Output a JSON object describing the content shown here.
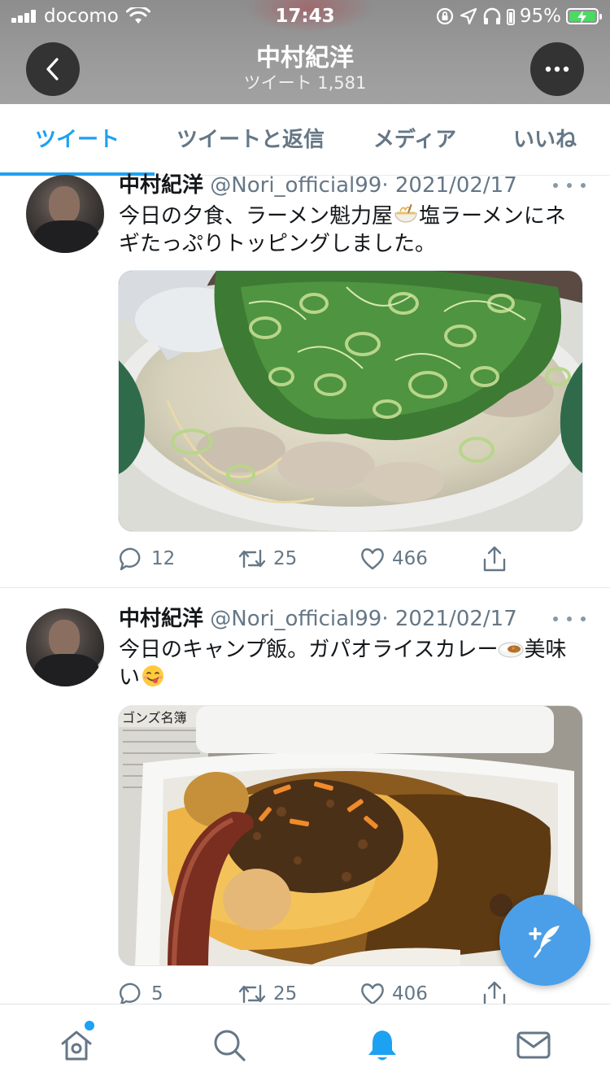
{
  "status_bar": {
    "carrier": "docomo",
    "time": "17:43",
    "battery_percent": "95%",
    "icons": [
      "signal-icon",
      "wifi-icon",
      "orientation-lock-icon",
      "location-icon",
      "headphones-icon",
      "battery-charging-icon"
    ]
  },
  "header": {
    "title": "中村紀洋",
    "subtitle": "ツイート 1,581",
    "back_icon": "chevron-left-icon",
    "more_icon": "more-horizontal-icon"
  },
  "tabs": [
    {
      "label": "ツイート",
      "active": true
    },
    {
      "label": "ツイートと返信",
      "active": false
    },
    {
      "label": "メディア",
      "active": false
    },
    {
      "label": "いいね",
      "active": false
    }
  ],
  "tweets": [
    {
      "name": "中村紀洋",
      "handle": "@Nori_official99",
      "separator": "·",
      "date": "2021/02/17",
      "text_a": "今日の夕食、ラーメン魁力屋",
      "emoji_a": "ramen-emoji",
      "text_b": "塩ラーメンにネギたっぷりトッピングしました。",
      "media": "photo of shio ramen topped with green onions",
      "replies": "12",
      "retweets": "25",
      "likes": "466"
    },
    {
      "name": "中村紀洋",
      "handle": "@Nori_official99",
      "separator": "·",
      "date": "2021/02/17",
      "text_a": "今日のキャンプ飯。ガパオライスカレー",
      "emoji_a": "curry-emoji",
      "text_b": "美味い",
      "emoji_b": "yum-face-emoji",
      "media_sign": "ゴンズ名簿",
      "media": "photo of gapao rice curry in a takeout box",
      "replies": "5",
      "retweets": "25",
      "likes": "406"
    }
  ],
  "fab": {
    "icon": "compose-tweet-icon"
  },
  "bottom_nav": [
    {
      "name": "home",
      "icon": "home-icon",
      "active": false,
      "badge": true
    },
    {
      "name": "search",
      "icon": "search-icon",
      "active": false
    },
    {
      "name": "notifications",
      "icon": "bell-icon",
      "active": true
    },
    {
      "name": "messages",
      "icon": "mail-icon",
      "active": false
    }
  ],
  "colors": {
    "accent": "#1da1f2",
    "text_primary": "#14171a",
    "text_secondary": "#657786",
    "fab": "#4a9fe8"
  }
}
